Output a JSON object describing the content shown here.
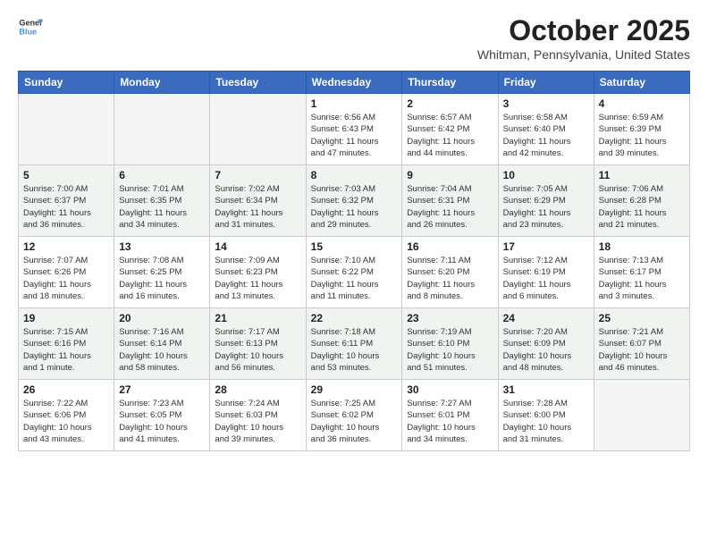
{
  "logo": {
    "general": "General",
    "blue": "Blue"
  },
  "title": "October 2025",
  "location": "Whitman, Pennsylvania, United States",
  "days_of_week": [
    "Sunday",
    "Monday",
    "Tuesday",
    "Wednesday",
    "Thursday",
    "Friday",
    "Saturday"
  ],
  "weeks": [
    [
      {
        "day": "",
        "info": ""
      },
      {
        "day": "",
        "info": ""
      },
      {
        "day": "",
        "info": ""
      },
      {
        "day": "1",
        "info": "Sunrise: 6:56 AM\nSunset: 6:43 PM\nDaylight: 11 hours\nand 47 minutes."
      },
      {
        "day": "2",
        "info": "Sunrise: 6:57 AM\nSunset: 6:42 PM\nDaylight: 11 hours\nand 44 minutes."
      },
      {
        "day": "3",
        "info": "Sunrise: 6:58 AM\nSunset: 6:40 PM\nDaylight: 11 hours\nand 42 minutes."
      },
      {
        "day": "4",
        "info": "Sunrise: 6:59 AM\nSunset: 6:39 PM\nDaylight: 11 hours\nand 39 minutes."
      }
    ],
    [
      {
        "day": "5",
        "info": "Sunrise: 7:00 AM\nSunset: 6:37 PM\nDaylight: 11 hours\nand 36 minutes."
      },
      {
        "day": "6",
        "info": "Sunrise: 7:01 AM\nSunset: 6:35 PM\nDaylight: 11 hours\nand 34 minutes."
      },
      {
        "day": "7",
        "info": "Sunrise: 7:02 AM\nSunset: 6:34 PM\nDaylight: 11 hours\nand 31 minutes."
      },
      {
        "day": "8",
        "info": "Sunrise: 7:03 AM\nSunset: 6:32 PM\nDaylight: 11 hours\nand 29 minutes."
      },
      {
        "day": "9",
        "info": "Sunrise: 7:04 AM\nSunset: 6:31 PM\nDaylight: 11 hours\nand 26 minutes."
      },
      {
        "day": "10",
        "info": "Sunrise: 7:05 AM\nSunset: 6:29 PM\nDaylight: 11 hours\nand 23 minutes."
      },
      {
        "day": "11",
        "info": "Sunrise: 7:06 AM\nSunset: 6:28 PM\nDaylight: 11 hours\nand 21 minutes."
      }
    ],
    [
      {
        "day": "12",
        "info": "Sunrise: 7:07 AM\nSunset: 6:26 PM\nDaylight: 11 hours\nand 18 minutes."
      },
      {
        "day": "13",
        "info": "Sunrise: 7:08 AM\nSunset: 6:25 PM\nDaylight: 11 hours\nand 16 minutes."
      },
      {
        "day": "14",
        "info": "Sunrise: 7:09 AM\nSunset: 6:23 PM\nDaylight: 11 hours\nand 13 minutes."
      },
      {
        "day": "15",
        "info": "Sunrise: 7:10 AM\nSunset: 6:22 PM\nDaylight: 11 hours\nand 11 minutes."
      },
      {
        "day": "16",
        "info": "Sunrise: 7:11 AM\nSunset: 6:20 PM\nDaylight: 11 hours\nand 8 minutes."
      },
      {
        "day": "17",
        "info": "Sunrise: 7:12 AM\nSunset: 6:19 PM\nDaylight: 11 hours\nand 6 minutes."
      },
      {
        "day": "18",
        "info": "Sunrise: 7:13 AM\nSunset: 6:17 PM\nDaylight: 11 hours\nand 3 minutes."
      }
    ],
    [
      {
        "day": "19",
        "info": "Sunrise: 7:15 AM\nSunset: 6:16 PM\nDaylight: 11 hours\nand 1 minute."
      },
      {
        "day": "20",
        "info": "Sunrise: 7:16 AM\nSunset: 6:14 PM\nDaylight: 10 hours\nand 58 minutes."
      },
      {
        "day": "21",
        "info": "Sunrise: 7:17 AM\nSunset: 6:13 PM\nDaylight: 10 hours\nand 56 minutes."
      },
      {
        "day": "22",
        "info": "Sunrise: 7:18 AM\nSunset: 6:11 PM\nDaylight: 10 hours\nand 53 minutes."
      },
      {
        "day": "23",
        "info": "Sunrise: 7:19 AM\nSunset: 6:10 PM\nDaylight: 10 hours\nand 51 minutes."
      },
      {
        "day": "24",
        "info": "Sunrise: 7:20 AM\nSunset: 6:09 PM\nDaylight: 10 hours\nand 48 minutes."
      },
      {
        "day": "25",
        "info": "Sunrise: 7:21 AM\nSunset: 6:07 PM\nDaylight: 10 hours\nand 46 minutes."
      }
    ],
    [
      {
        "day": "26",
        "info": "Sunrise: 7:22 AM\nSunset: 6:06 PM\nDaylight: 10 hours\nand 43 minutes."
      },
      {
        "day": "27",
        "info": "Sunrise: 7:23 AM\nSunset: 6:05 PM\nDaylight: 10 hours\nand 41 minutes."
      },
      {
        "day": "28",
        "info": "Sunrise: 7:24 AM\nSunset: 6:03 PM\nDaylight: 10 hours\nand 39 minutes."
      },
      {
        "day": "29",
        "info": "Sunrise: 7:25 AM\nSunset: 6:02 PM\nDaylight: 10 hours\nand 36 minutes."
      },
      {
        "day": "30",
        "info": "Sunrise: 7:27 AM\nSunset: 6:01 PM\nDaylight: 10 hours\nand 34 minutes."
      },
      {
        "day": "31",
        "info": "Sunrise: 7:28 AM\nSunset: 6:00 PM\nDaylight: 10 hours\nand 31 minutes."
      },
      {
        "day": "",
        "info": ""
      }
    ]
  ]
}
